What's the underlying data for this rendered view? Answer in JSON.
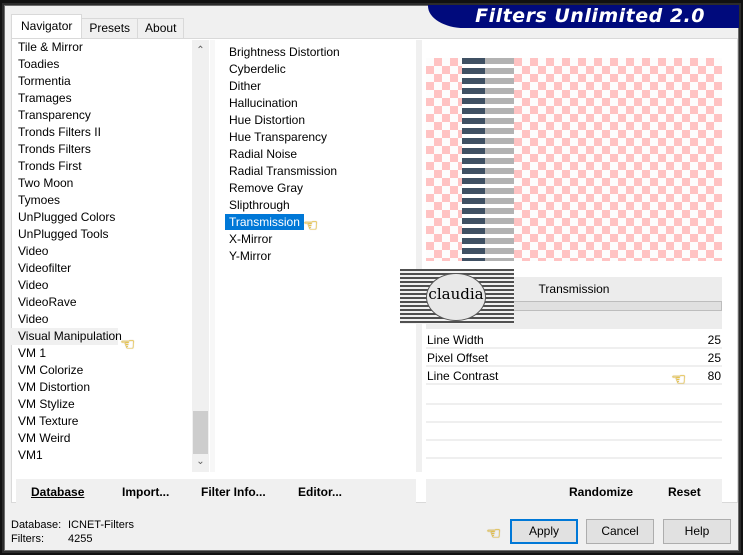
{
  "app": {
    "brand_title": "Filters Unlimited 2.0"
  },
  "tabs": [
    {
      "label": "Navigator",
      "active": true
    },
    {
      "label": "Presets",
      "active": false
    },
    {
      "label": "About",
      "active": false
    }
  ],
  "categories": {
    "items": [
      "Tile & Mirror",
      "Toadies",
      "Tormentia",
      "Tramages",
      "Transparency",
      "Tronds Filters II",
      "Tronds Filters",
      "Tronds First",
      "Two Moon",
      "Tymoes",
      "UnPlugged Colors",
      "UnPlugged Tools",
      "Video",
      "Videofilter",
      "Video",
      "VideoRave",
      "Video",
      "Visual Manipulation",
      "VM 1",
      "VM Colorize",
      "VM Distortion",
      "VM Stylize",
      "VM Texture",
      "VM Weird",
      "VM1"
    ],
    "highlighted": "Visual Manipulation"
  },
  "filters": {
    "items": [
      "Brightness Distortion",
      "Cyberdelic",
      "Dither",
      "Hallucination",
      "Hue Distortion",
      "Hue Transparency",
      "Radial Noise",
      "Radial Transmission",
      "Remove Gray",
      "Slipthrough",
      "Transmission",
      "X-Mirror",
      "Y-Mirror"
    ],
    "selected": "Transmission"
  },
  "preview": {
    "filter_title": "Transmission",
    "watermark_text": "claudia"
  },
  "parameters": [
    {
      "label": "Line Width",
      "value": "25"
    },
    {
      "label": "Pixel Offset",
      "value": "25"
    },
    {
      "label": "Line Contrast",
      "value": "80"
    }
  ],
  "toolbar": {
    "database": "Database",
    "import": "Import...",
    "filter_info": "Filter Info...",
    "editor": "Editor...",
    "randomize": "Randomize",
    "reset": "Reset"
  },
  "status": {
    "database_label": "Database:",
    "database_value": "ICNET-Filters",
    "filters_label": "Filters:",
    "filters_value": "4255"
  },
  "buttons": {
    "apply": "Apply",
    "cancel": "Cancel",
    "help": "Help"
  },
  "colors": {
    "brand_bg": "#000a7c",
    "selection": "#0078d7",
    "checker": "#ffc3c3"
  }
}
